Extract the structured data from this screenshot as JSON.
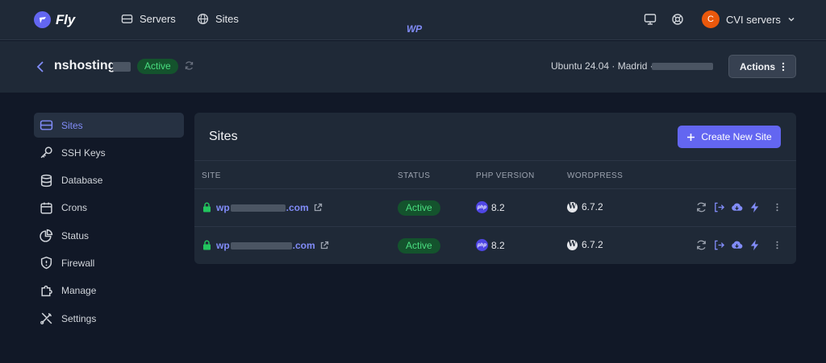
{
  "app": {
    "logo_fly": "Fly",
    "logo_wp": "WP",
    "nav": [
      {
        "label": "Servers",
        "icon": "server-icon"
      },
      {
        "label": "Sites",
        "icon": "globe-icon"
      }
    ],
    "account": {
      "initial": "C",
      "name": "CVI servers"
    }
  },
  "server": {
    "name": "nshosting",
    "status": "Active",
    "meta": "Ubuntu 24.04 · Madrid ·",
    "actions_label": "Actions"
  },
  "sidebar": {
    "items": [
      {
        "label": "Sites",
        "icon": "sites-icon",
        "active": true
      },
      {
        "label": "SSH Keys",
        "icon": "key-icon",
        "active": false
      },
      {
        "label": "Database",
        "icon": "database-icon",
        "active": false
      },
      {
        "label": "Crons",
        "icon": "calendar-icon",
        "active": false
      },
      {
        "label": "Status",
        "icon": "pie-chart-icon",
        "active": false
      },
      {
        "label": "Firewall",
        "icon": "shield-icon",
        "active": false
      },
      {
        "label": "Manage",
        "icon": "puzzle-icon",
        "active": false
      },
      {
        "label": "Settings",
        "icon": "tools-icon",
        "active": false
      }
    ]
  },
  "sites_panel": {
    "title": "Sites",
    "create_label": "Create New Site",
    "columns": [
      "SITE",
      "STATUS",
      "PHP VERSION",
      "WORDPRESS"
    ],
    "rows": [
      {
        "site_prefix": "wp",
        "site_suffix": ".com",
        "status": "Active",
        "php": "8.2",
        "wordpress": "6.7.2"
      },
      {
        "site_prefix": "wp",
        "site_suffix": ".com",
        "status": "Active",
        "php": "8.2",
        "wordpress": "6.7.2"
      }
    ]
  },
  "colors": {
    "background": "#111827",
    "panel": "#1f2937",
    "accent": "#6366f1",
    "link": "#818cf8",
    "success_text": "#4ade80",
    "success_bg": "#14532d",
    "avatar": "#ea580c"
  }
}
